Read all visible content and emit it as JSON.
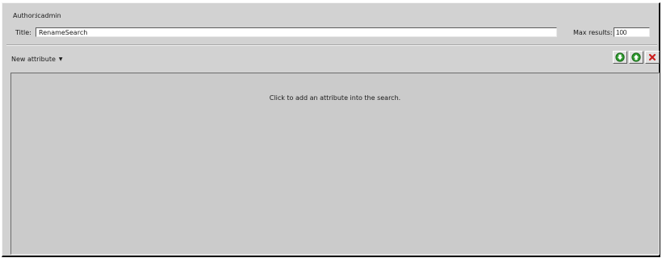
{
  "header": {
    "author_label": "Author:",
    "author_value": "icadmin",
    "title_label": "Title:",
    "title_value": "RenameSearch",
    "max_results_label": "Max results:",
    "max_results_value": "100"
  },
  "toolbar": {
    "new_attribute_label": "New attribute",
    "new_attribute_caret": "▼",
    "buttons": [
      {
        "icon": "move-down-icon",
        "color": "#2e9a2e"
      },
      {
        "icon": "move-up-icon",
        "color": "#2e9a2e"
      },
      {
        "icon": "delete-icon",
        "color": "#cc1f1f"
      }
    ]
  },
  "workspace": {
    "hint": "Click to add an attribute into the search."
  }
}
